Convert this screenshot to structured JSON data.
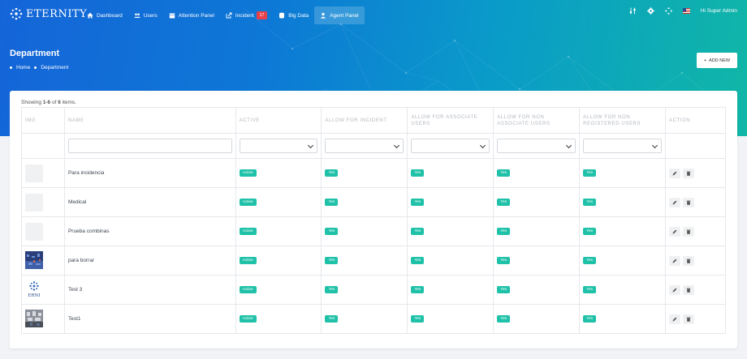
{
  "brand": {
    "name": "ETERNITY"
  },
  "nav": {
    "items": [
      {
        "label": "Dashboard",
        "icon": "home-icon"
      },
      {
        "label": "Users",
        "icon": "users-icon"
      },
      {
        "label": "Attention Panel",
        "icon": "calendar-icon"
      },
      {
        "label": "Incident",
        "icon": "share-icon",
        "badge": "17"
      },
      {
        "label": "Big Data",
        "icon": "database-icon"
      },
      {
        "label": "Agent Panel",
        "icon": "agent-icon"
      }
    ],
    "user_greeting": "Hi Super Admin"
  },
  "page": {
    "title": "Department",
    "breadcrumb": [
      "Home",
      "Department"
    ],
    "add_button": "ADD NEW"
  },
  "table": {
    "summary_prefix": "Showing ",
    "summary_range": "1-6",
    "summary_mid": " of ",
    "summary_total": "6",
    "summary_suffix": " items.",
    "columns": [
      "IMG",
      "NAME",
      "ACTIVE",
      "ALLOW FOR INCIDENT",
      "ALLOW FOR ASSOCIATE USERS",
      "ALLOW FOR NON ASSOCIATE USERS",
      "ALLOW FOR NON REGISTERED USERS",
      "ACTION"
    ],
    "rows": [
      {
        "name": "Para incidencia",
        "active": "Active",
        "incident": "Yes",
        "assoc": "Yes",
        "nonassoc": "Yes",
        "nonreg": "Yes"
      },
      {
        "name": "Medical",
        "active": "Active",
        "incident": "Yes",
        "assoc": "Yes",
        "nonassoc": "Yes",
        "nonreg": "Yes"
      },
      {
        "name": "Prueba combinas",
        "active": "Active",
        "incident": "Yes",
        "assoc": "Yes",
        "nonassoc": "Yes",
        "nonreg": "Yes"
      },
      {
        "name": "para borrar",
        "active": "Active",
        "incident": "Yes",
        "assoc": "Yes",
        "nonassoc": "Yes",
        "nonreg": "Yes"
      },
      {
        "name": "Test 3",
        "active": "Active",
        "incident": "Yes",
        "assoc": "Yes",
        "nonassoc": "Yes",
        "nonreg": "Yes"
      },
      {
        "name": "Test1",
        "active": "Active",
        "incident": "Yes",
        "assoc": "Yes",
        "nonassoc": "Yes",
        "nonreg": "Yes"
      }
    ],
    "thumb_logo_text": "ERNI"
  },
  "colors": {
    "accent": "#1fc1a8",
    "header_start": "#1565d8",
    "header_end": "#10b7a6",
    "badge": "#e8434c"
  }
}
